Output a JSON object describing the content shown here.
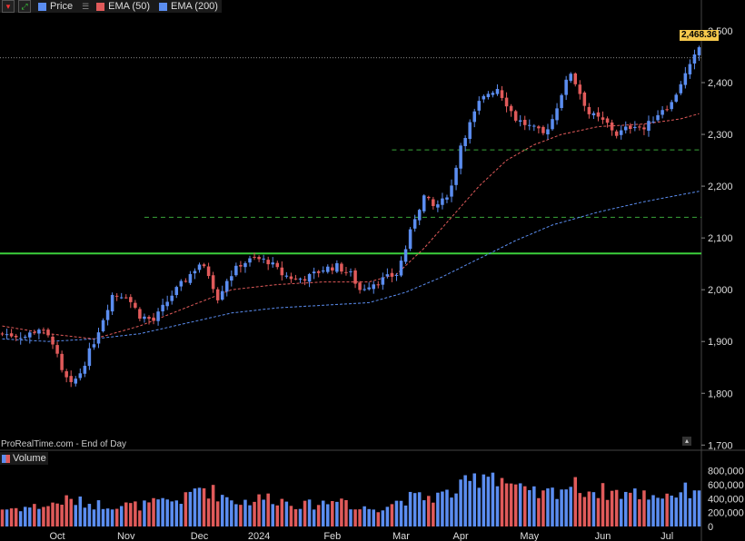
{
  "legend": {
    "price_label": "Price",
    "ema50_label": "EMA (50)",
    "ema200_label": "EMA (200)",
    "price_color": "#5b8df0",
    "ema50_color": "#e05a5a",
    "ema200_color": "#5b8df0"
  },
  "credit": "ProRealTime.com - End of Day",
  "volume_label": "Volume",
  "last_price": "2,468.36",
  "colors": {
    "up": "#5b8df0",
    "down": "#e05a5a",
    "support": "#3ccf3c",
    "dashed_support": "#3aa63a",
    "background": "#000000",
    "grid_text": "#dddddd"
  },
  "chart_data": {
    "type": "candlestick",
    "y_ticks": [
      "2,500",
      "2,400",
      "2,300",
      "2,200",
      "2,100",
      "2,000",
      "1,900",
      "1,800",
      "1,700"
    ],
    "y_tick_values": [
      2500,
      2400,
      2300,
      2200,
      2100,
      2000,
      1900,
      1800,
      1700
    ],
    "ylim": [
      1690,
      2535
    ],
    "x_ticks": [
      "Oct",
      "Nov",
      "Dec",
      "2024",
      "Feb",
      "Mar",
      "Apr",
      "May",
      "Jun",
      "Jul"
    ],
    "x_tick_index": [
      12,
      27,
      43,
      56,
      72,
      87,
      100,
      115,
      131,
      145
    ],
    "n_bars": 153,
    "close_anchors": [
      [
        0,
        1915
      ],
      [
        5,
        1910
      ],
      [
        8,
        1925
      ],
      [
        11,
        1900
      ],
      [
        13,
        1840
      ],
      [
        15,
        1815
      ],
      [
        17,
        1840
      ],
      [
        20,
        1900
      ],
      [
        24,
        1990
      ],
      [
        27,
        1990
      ],
      [
        30,
        1950
      ],
      [
        33,
        1940
      ],
      [
        37,
        1990
      ],
      [
        41,
        2030
      ],
      [
        43,
        2050
      ],
      [
        45,
        2030
      ],
      [
        47,
        1985
      ],
      [
        49,
        2020
      ],
      [
        52,
        2050
      ],
      [
        55,
        2060
      ],
      [
        58,
        2055
      ],
      [
        61,
        2030
      ],
      [
        64,
        2020
      ],
      [
        67,
        2025
      ],
      [
        70,
        2040
      ],
      [
        73,
        2045
      ],
      [
        76,
        2030
      ],
      [
        78,
        2000
      ],
      [
        80,
        2010
      ],
      [
        83,
        2020
      ],
      [
        86,
        2030
      ],
      [
        88,
        2080
      ],
      [
        90,
        2140
      ],
      [
        92,
        2180
      ],
      [
        94,
        2160
      ],
      [
        96,
        2170
      ],
      [
        98,
        2200
      ],
      [
        100,
        2280
      ],
      [
        102,
        2320
      ],
      [
        104,
        2360
      ],
      [
        106,
        2380
      ],
      [
        108,
        2390
      ],
      [
        110,
        2360
      ],
      [
        112,
        2330
      ],
      [
        114,
        2320
      ],
      [
        116,
        2310
      ],
      [
        118,
        2300
      ],
      [
        120,
        2330
      ],
      [
        122,
        2380
      ],
      [
        124,
        2420
      ],
      [
        126,
        2380
      ],
      [
        128,
        2340
      ],
      [
        130,
        2330
      ],
      [
        132,
        2320
      ],
      [
        134,
        2300
      ],
      [
        136,
        2310
      ],
      [
        138,
        2320
      ],
      [
        140,
        2310
      ],
      [
        142,
        2330
      ],
      [
        144,
        2350
      ],
      [
        146,
        2360
      ],
      [
        148,
        2400
      ],
      [
        150,
        2430
      ],
      [
        152,
        2468
      ]
    ],
    "ema50_anchors": [
      [
        0,
        1930
      ],
      [
        10,
        1915
      ],
      [
        20,
        1905
      ],
      [
        30,
        1930
      ],
      [
        40,
        1965
      ],
      [
        50,
        2000
      ],
      [
        60,
        2010
      ],
      [
        70,
        2015
      ],
      [
        80,
        2015
      ],
      [
        86,
        2030
      ],
      [
        92,
        2080
      ],
      [
        98,
        2140
      ],
      [
        104,
        2200
      ],
      [
        110,
        2250
      ],
      [
        116,
        2280
      ],
      [
        122,
        2300
      ],
      [
        130,
        2315
      ],
      [
        140,
        2320
      ],
      [
        148,
        2330
      ],
      [
        152,
        2340
      ]
    ],
    "ema200_anchors": [
      [
        0,
        1905
      ],
      [
        10,
        1900
      ],
      [
        20,
        1905
      ],
      [
        30,
        1915
      ],
      [
        40,
        1935
      ],
      [
        50,
        1955
      ],
      [
        60,
        1965
      ],
      [
        70,
        1970
      ],
      [
        80,
        1975
      ],
      [
        88,
        1995
      ],
      [
        96,
        2025
      ],
      [
        104,
        2060
      ],
      [
        112,
        2095
      ],
      [
        120,
        2125
      ],
      [
        130,
        2150
      ],
      [
        140,
        2170
      ],
      [
        152,
        2190
      ]
    ],
    "volume_anchors": [
      [
        0,
        250000
      ],
      [
        10,
        300000
      ],
      [
        14,
        380000
      ],
      [
        20,
        320000
      ],
      [
        30,
        300000
      ],
      [
        40,
        400000
      ],
      [
        43,
        580000
      ],
      [
        47,
        470000
      ],
      [
        52,
        350000
      ],
      [
        58,
        420000
      ],
      [
        66,
        300000
      ],
      [
        72,
        360000
      ],
      [
        74,
        500000
      ],
      [
        76,
        250000
      ],
      [
        82,
        270000
      ],
      [
        88,
        400000
      ],
      [
        94,
        430000
      ],
      [
        98,
        480000
      ],
      [
        100,
        550000
      ],
      [
        104,
        720000
      ],
      [
        106,
        820000
      ],
      [
        110,
        650000
      ],
      [
        114,
        480000
      ],
      [
        118,
        450000
      ],
      [
        124,
        600000
      ],
      [
        128,
        520000
      ],
      [
        132,
        500000
      ],
      [
        138,
        470000
      ],
      [
        144,
        450000
      ],
      [
        150,
        520000
      ],
      [
        152,
        600000
      ]
    ],
    "volume_ticks": [
      "800,000",
      "600,000",
      "400,000",
      "200,000",
      "0"
    ],
    "volume_tick_values": [
      800000,
      600000,
      400000,
      200000,
      0
    ],
    "volume_ylim": [
      0,
      860000
    ],
    "support_level": 2070,
    "dashed_levels": [
      {
        "y": 2270,
        "x_start": 85
      },
      {
        "y": 2140,
        "x_start": 31
      }
    ],
    "last_price_line": 2448
  }
}
